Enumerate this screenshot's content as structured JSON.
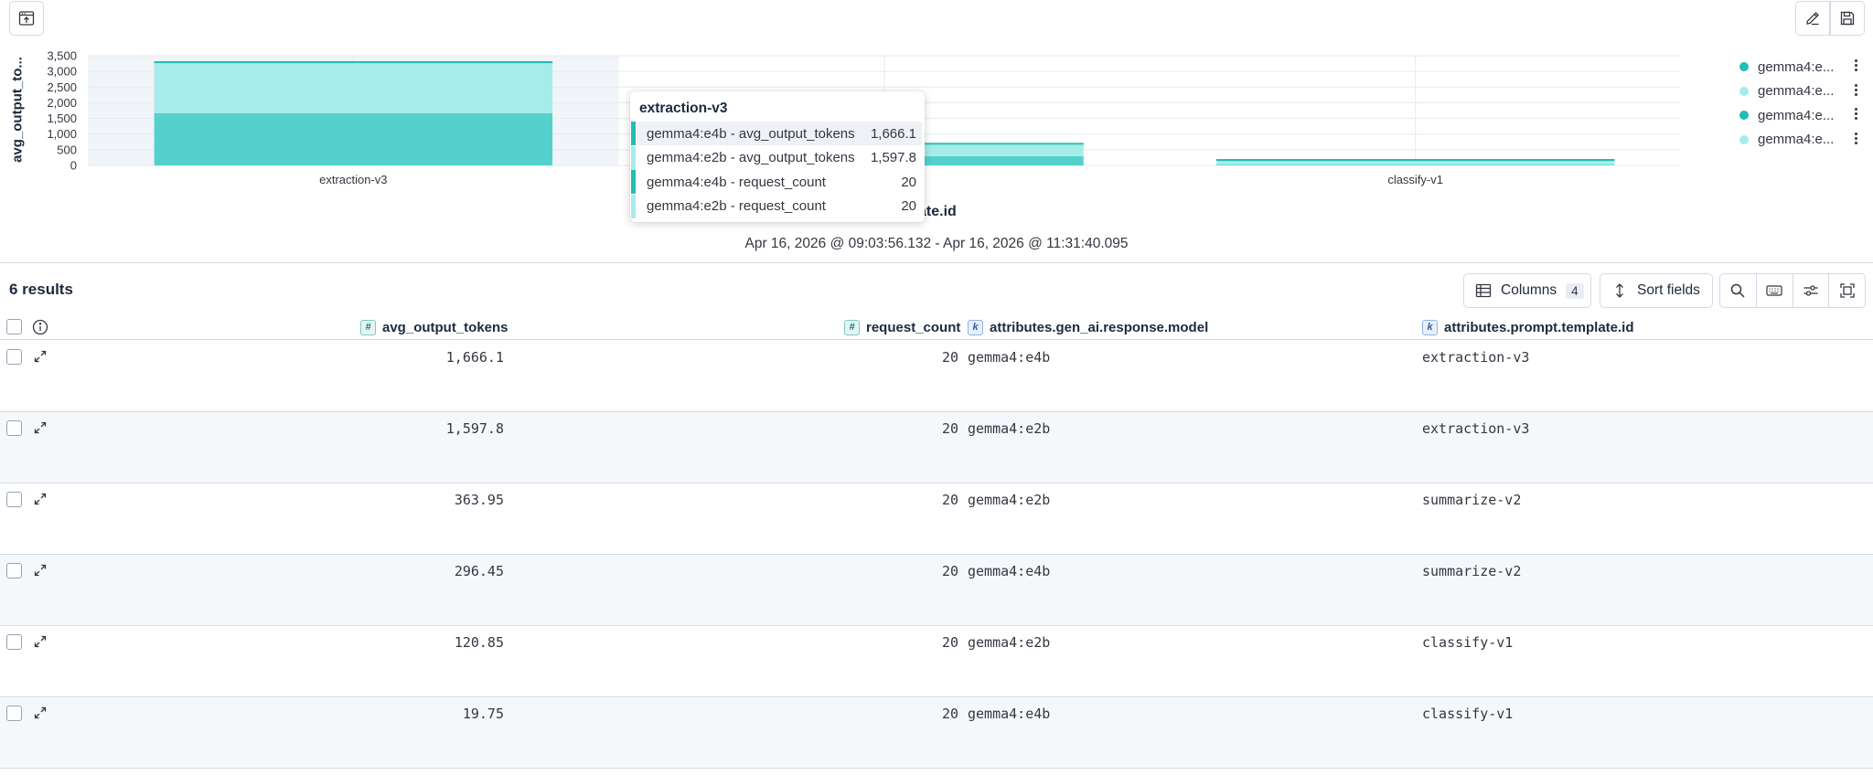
{
  "chart_data": {
    "type": "bar",
    "stacked": true,
    "title": "",
    "xlabel": "attributes.prompt.template.id",
    "ylabel": "avg_output_to...",
    "ylim": [
      0,
      3500
    ],
    "yticks": [
      "3,500",
      "3,000",
      "2,500",
      "2,000",
      "1,500",
      "1,000",
      "500",
      "0"
    ],
    "categories": [
      "extraction-v3",
      "summarize-v2",
      "classify-v1"
    ],
    "series": [
      {
        "name": "gemma4:e4b - avg_output_tokens",
        "color": "#54d1cc",
        "values": [
          1666.1,
          296.45,
          19.75
        ]
      },
      {
        "name": "gemma4:e2b - avg_output_tokens",
        "color": "#a6ece8",
        "values": [
          1597.8,
          363.95,
          120.85
        ]
      },
      {
        "name": "gemma4:e4b - request_count",
        "color": "#21bdb5",
        "values": [
          20,
          20,
          20
        ]
      },
      {
        "name": "gemma4:e2b - request_count",
        "color": "#c4f2ef",
        "values": [
          20,
          20,
          20
        ]
      }
    ],
    "grid": true,
    "legend_position": "right"
  },
  "chart": {
    "xlabel_visible": "nplate.id",
    "time_range": "Apr 16, 2026 @ 09:03:56.132 - Apr 16, 2026 @ 11:31:40.095",
    "legend": [
      {
        "label": "gemma4:e...",
        "color": "#21bdb5"
      },
      {
        "label": "gemma4:e...",
        "color": "#a6ece8"
      },
      {
        "label": "gemma4:e...",
        "color": "#21bdb5"
      },
      {
        "label": "gemma4:e...",
        "color": "#a6ece8"
      }
    ]
  },
  "tooltip": {
    "title": "extraction-v3",
    "rows": [
      {
        "label": "gemma4:e4b - avg_output_tokens",
        "value": "1,666.1",
        "color": "#21bdb5"
      },
      {
        "label": "gemma4:e2b - avg_output_tokens",
        "value": "1,597.8",
        "color": "#a6ece8"
      },
      {
        "label": "gemma4:e4b - request_count",
        "value": "20",
        "color": "#21bdb5"
      },
      {
        "label": "gemma4:e2b - request_count",
        "value": "20",
        "color": "#a6ece8"
      }
    ]
  },
  "results": {
    "count_label": "6 results",
    "columns_label": "Columns",
    "columns_count": "4",
    "sort_label": "Sort fields"
  },
  "table": {
    "headers": {
      "avg_output_tokens": "avg_output_tokens",
      "request_count": "request_count",
      "model": "attributes.gen_ai.response.model",
      "template": "attributes.prompt.template.id"
    },
    "type_tokens": {
      "number": "#",
      "keyword": "k"
    },
    "rows": [
      {
        "avg": "1,666.1",
        "count": "20",
        "model": "gemma4:e4b",
        "template": "extraction-v3"
      },
      {
        "avg": "1,597.8",
        "count": "20",
        "model": "gemma4:e2b",
        "template": "extraction-v3"
      },
      {
        "avg": "363.95",
        "count": "20",
        "model": "gemma4:e2b",
        "template": "summarize-v2"
      },
      {
        "avg": "296.45",
        "count": "20",
        "model": "gemma4:e4b",
        "template": "summarize-v2"
      },
      {
        "avg": "120.85",
        "count": "20",
        "model": "gemma4:e2b",
        "template": "classify-v1"
      },
      {
        "avg": "19.75",
        "count": "20",
        "model": "gemma4:e4b",
        "template": "classify-v1"
      }
    ]
  }
}
